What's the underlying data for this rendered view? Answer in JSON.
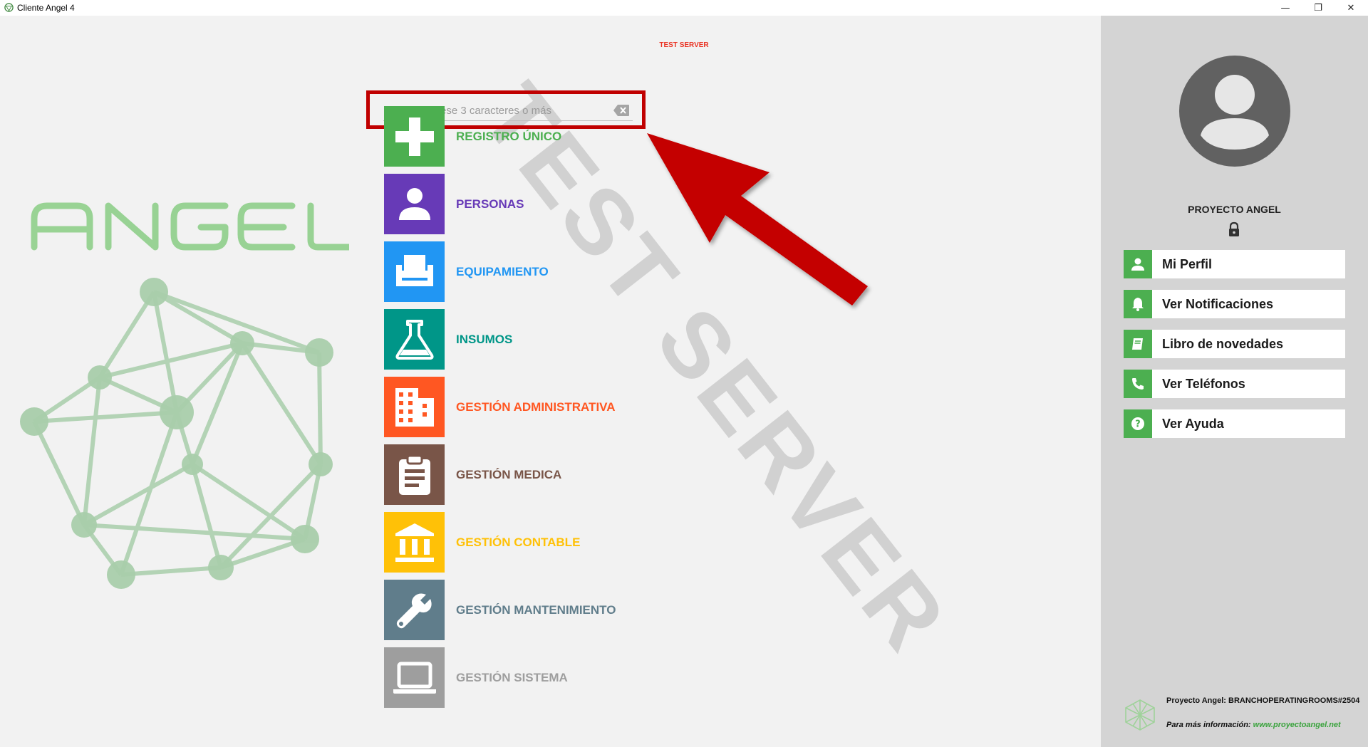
{
  "window": {
    "title": "Cliente Angel 4",
    "minimize_glyph": "—",
    "maximize_glyph": "❐",
    "close_glyph": "✕"
  },
  "server_label": "TEST SERVER",
  "watermark": "TEST SERVER",
  "brand": {
    "logo_text": "ANGEL",
    "logo_color": "#8fcf8a"
  },
  "search": {
    "placeholder": "Buscar. Ingrese 3 caracteres o más",
    "value": "",
    "highlight_color": "#c00000"
  },
  "modules": [
    {
      "label": "REGISTRO ÚNICO",
      "color": "#4caf50",
      "icon": "plus-icon"
    },
    {
      "label": "PERSONAS",
      "color": "#673ab7",
      "icon": "person-icon"
    },
    {
      "label": "EQUIPAMIENTO",
      "color": "#2196f3",
      "icon": "bed-icon"
    },
    {
      "label": "INSUMOS",
      "color": "#009688",
      "icon": "flask-icon"
    },
    {
      "label": "GESTIÓN ADMINISTRATIVA",
      "color": "#ff5722",
      "icon": "building-icon"
    },
    {
      "label": "GESTIÓN MEDICA",
      "color": "#795548",
      "icon": "clipboard-icon"
    },
    {
      "label": "GESTIÓN CONTABLE",
      "color": "#ffc107",
      "icon": "bank-icon"
    },
    {
      "label": "GESTIÓN MANTENIMIENTO",
      "color": "#607d8b",
      "icon": "wrench-icon"
    },
    {
      "label": "GESTIÓN SISTEMA",
      "color": "#9e9e9e",
      "icon": "laptop-icon"
    }
  ],
  "user": {
    "name": "PROYECTO ANGEL",
    "avatar_icon": "account-circle-icon",
    "lock_icon": "lock-icon"
  },
  "side_menu": [
    {
      "label": "Mi Perfil",
      "icon": "user-icon"
    },
    {
      "label": "Ver Notificaciones",
      "icon": "bell-icon"
    },
    {
      "label": "Libro de novedades",
      "icon": "book-icon"
    },
    {
      "label": "Ver Teléfonos",
      "icon": "phone-icon"
    },
    {
      "label": "Ver Ayuda",
      "icon": "help-icon"
    }
  ],
  "footer": {
    "line1": "Proyecto Angel: BRANCHOPERATINGROOMS#2504",
    "info_prefix": "Para más información:",
    "link": "www.proyectoangel.net"
  }
}
